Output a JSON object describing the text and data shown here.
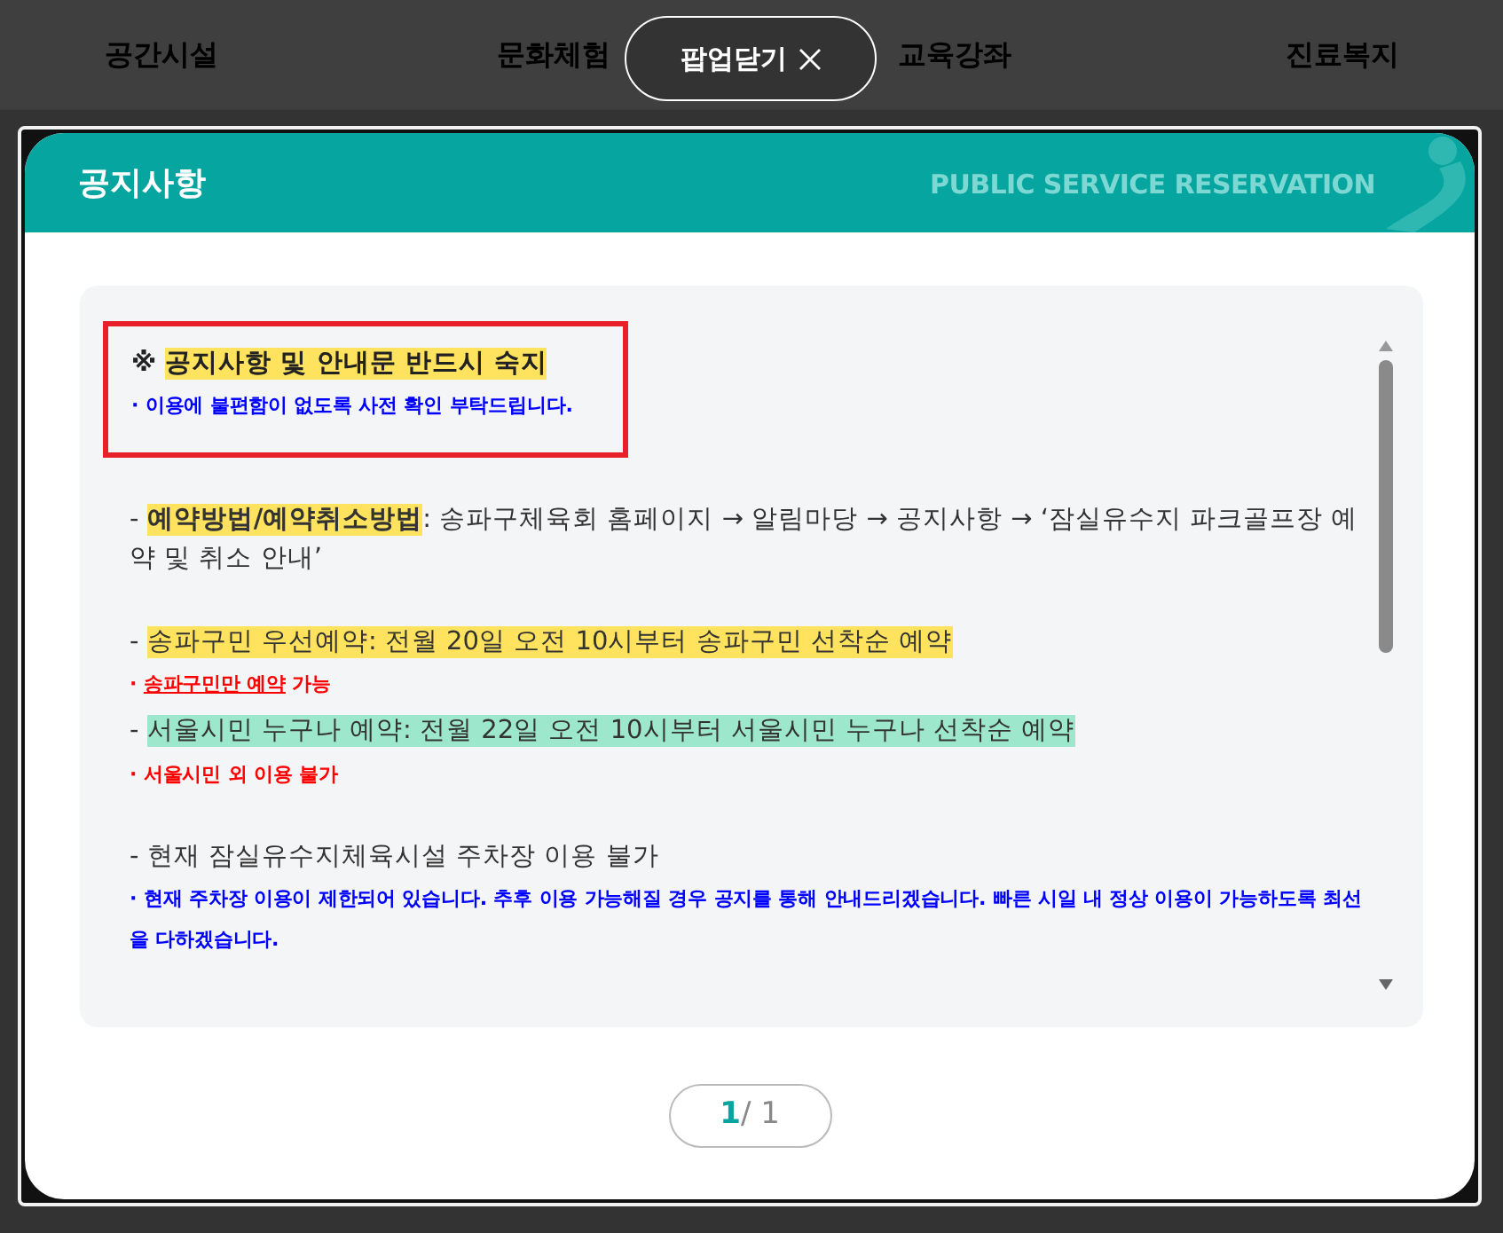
{
  "nav": {
    "tabs": [
      {
        "label": "공간시설"
      },
      {
        "label": "문화체험"
      },
      {
        "label": "교육강좌"
      },
      {
        "label": "진료복지"
      }
    ],
    "close_button": "팝업닫기"
  },
  "modal": {
    "title": "공지사항",
    "tagline": "PUBLIC SERVICE RESERVATION",
    "groups": [
      [
        {
          "kind": "boxed",
          "marker": "※",
          "highlight": "공지사항 및 안내문 반드시 숙지",
          "color": "#ffe35e",
          "note": {
            "prefix": "· ",
            "text": "이용에 불편함이 없도록 사전 확인 부탁드립니다.",
            "color": "#0000ff"
          }
        }
      ],
      [
        {
          "kind": "line",
          "marker": "-",
          "highlight": "**예약방법/예약취소방법**",
          "color": "#ffe35e",
          "text": ": 송파구체육회 홈페이지 → 알림마당 → 공지사항 → ‘잠실유수지 파크골프장 예약 및 취소 안내’"
        }
      ],
      [
        {
          "kind": "line",
          "marker": "-",
          "highlight": "송파구민 우선예약: 전월 20일 오전 10시부터 송파구민 선착순 예약",
          "color": "#ffe35e",
          "note": {
            "prefix": "· ",
            "underlined": "송파구민만 예약",
            "text": " 가능",
            "color": "#ff0000"
          }
        },
        {
          "kind": "line",
          "marker": "-",
          "highlight": "서울시민 누구나 예약: 전월 22일 오전 10시부터 서울시민 누구나 선착순 예약",
          "color": "#9de8cc",
          "note": {
            "prefix": "· ",
            "text": "서울시민 외 이용 불가",
            "color": "#ff0000"
          }
        }
      ],
      [
        {
          "kind": "line",
          "marker": "-",
          "text": "현재 잠실유수지체육시설 주차장 이용 불가",
          "note": {
            "prefix": "· ",
            "text": "현재 주차장 이용이 제한되어 있습니다. 추후 이용 가능해질 경우 공지를 통해 안내드리겠습니다. 빠른 시일 내 정상 이용이 가능하도록 최선을 다하겠습니다.",
            "color": "#0000ff"
          }
        }
      ]
    ],
    "pager": {
      "current": "1",
      "separator": "/",
      "total": "1"
    }
  }
}
